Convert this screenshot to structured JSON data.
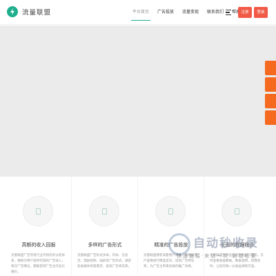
{
  "brand": {
    "name": "流量联盟"
  },
  "nav": {
    "items": [
      {
        "label": "平台首页",
        "active": true
      },
      {
        "label": "广告投放",
        "active": false
      },
      {
        "label": "流量变现",
        "active": false
      },
      {
        "label": "联系我们",
        "active": false
      },
      {
        "label": "帮助中心",
        "active": false
      }
    ],
    "menu_icon": "menu-icon"
  },
  "auth": {
    "register_label": "注册",
    "login_label": "登录"
  },
  "colors": {
    "accent": "#1fae8d",
    "button": "#f05a46",
    "side": "#f56a1e",
    "banner": "#ebebeb"
  },
  "features": [
    {
      "title": "高额的收入回报",
      "desc": "流量联盟广告有有行业内领先的分成体系，确保为用户提供可观的广告收入，每次广告曝光，都能获得广告主的竞价报价。"
    },
    {
      "title": "多样的广告形式",
      "desc": "流量联盟广告形式多样，开屏、信息流、激励视频、插屏等广告形式，满足各类媒体场景需求，提高广告填充率。"
    },
    {
      "title": "精准的广告投放",
      "desc": "流量联盟拥有海量用户数据，可根据用户画像进行精准定向，提高广告转化率，为广告主带来优质的推广效果。"
    },
    {
      "title": "全面的数据统计",
      "desc": "流量联盟提供全面的数据统计服务，实时查看收益数据，数据透明，结算及时，让您的每一分收益清晰可查。"
    }
  ],
  "watermark": {
    "title": "自动秒收录",
    "subtitle": "快速链接·来访一次·自动收录"
  }
}
